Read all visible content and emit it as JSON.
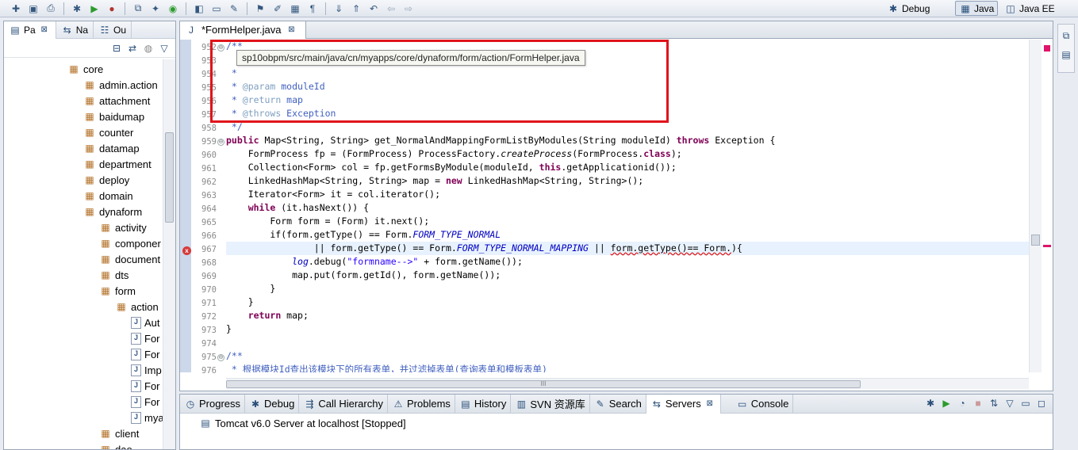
{
  "toolbar": {
    "perspectives": [
      {
        "label": "Debug",
        "icon": "debug-perspective-icon",
        "active": false
      },
      {
        "label": "Java",
        "icon": "java-perspective-icon",
        "active": true
      },
      {
        "label": "Java EE",
        "icon": "javaee-perspective-icon",
        "active": false
      }
    ]
  },
  "left_panel": {
    "tabs": [
      {
        "label": "Pa",
        "active": true,
        "close": "⊠"
      },
      {
        "label": "Na",
        "active": false
      },
      {
        "label": "Ou",
        "active": false
      }
    ],
    "tree": [
      {
        "label": "core",
        "depth": 0,
        "type": "package"
      },
      {
        "label": "admin.action",
        "depth": 1,
        "type": "package"
      },
      {
        "label": "attachment",
        "depth": 1,
        "type": "package"
      },
      {
        "label": "baidumap",
        "depth": 1,
        "type": "package"
      },
      {
        "label": "counter",
        "depth": 1,
        "type": "package"
      },
      {
        "label": "datamap",
        "depth": 1,
        "type": "package"
      },
      {
        "label": "department",
        "depth": 1,
        "type": "package"
      },
      {
        "label": "deploy",
        "depth": 1,
        "type": "package"
      },
      {
        "label": "domain",
        "depth": 1,
        "type": "package"
      },
      {
        "label": "dynaform",
        "depth": 1,
        "type": "package"
      },
      {
        "label": "activity",
        "depth": 2,
        "type": "package"
      },
      {
        "label": "componer",
        "depth": 2,
        "type": "package"
      },
      {
        "label": "document",
        "depth": 2,
        "type": "package"
      },
      {
        "label": "dts",
        "depth": 2,
        "type": "package"
      },
      {
        "label": "form",
        "depth": 2,
        "type": "package"
      },
      {
        "label": "action",
        "depth": 3,
        "type": "package"
      },
      {
        "label": "Aut",
        "depth": 4,
        "type": "file"
      },
      {
        "label": "For",
        "depth": 4,
        "type": "file"
      },
      {
        "label": "For",
        "depth": 4,
        "type": "file"
      },
      {
        "label": "Imp",
        "depth": 4,
        "type": "file"
      },
      {
        "label": "For",
        "depth": 4,
        "type": "file"
      },
      {
        "label": "For",
        "depth": 4,
        "type": "file"
      },
      {
        "label": "mya",
        "depth": 4,
        "type": "file"
      },
      {
        "label": "client",
        "depth": 2,
        "type": "package"
      },
      {
        "label": "dao",
        "depth": 2,
        "type": "package"
      }
    ]
  },
  "editor": {
    "tab_label": "*FormHelper.java",
    "tab_close": "⊠",
    "tooltip": "sp10obpm/src/main/java/cn/myapps/core/dynaform/form/action/FormHelper.java",
    "line_numbers": [
      "952",
      "953",
      "954",
      "955",
      "956",
      "957",
      "958",
      "959",
      "960",
      "961",
      "962",
      "963",
      "964",
      "965",
      "966",
      "967",
      "968",
      "969",
      "970",
      "971",
      "972",
      "973",
      "974",
      "975",
      "976"
    ],
    "error_marker": "x",
    "fold_marker": "⊖",
    "scroll_marker": "III",
    "lines": {
      "l952": "/**",
      "l954": " *",
      "l955_pre": " * ",
      "l955_tag": "@param",
      "l955_post": " moduleId",
      "l956_pre": " * ",
      "l956_tag": "@return",
      "l956_post": " map",
      "l957_pre": " * ",
      "l957_tag": "@throws",
      "l957_post": " Exception",
      "l958": " */",
      "l959_kw1": "public",
      "l959_mid": " Map<String, String> get_NormalAndMappingFormListByModules(String moduleId) ",
      "l959_kw2": "throws",
      "l959_post": " Exception {",
      "l960_a": "    FormProcess fp = (FormProcess) ProcessFactory.",
      "l960_it": "createProcess",
      "l960_b": "(FormProcess.",
      "l960_kw": "class",
      "l960_c": ");",
      "l961_a": "    Collection<Form> col = fp.getFormsByModule(moduleId, ",
      "l961_kw": "this",
      "l961_b": ".getApplicationid());",
      "l962_a": "    LinkedHashMap<String, String> map = ",
      "l962_kw": "new",
      "l962_b": " LinkedHashMap<String, String>();",
      "l963": "    Iterator<Form> it = col.iterator();",
      "l964_kw": "while",
      "l964_b": " (it.hasNext()) {",
      "l965": "        Form form = (Form) it.next();",
      "l966_a": "        if(form.getType() == Form.",
      "l966_fi": "FORM_TYPE_NORMAL",
      "l967_a": "                || form.getType() == Form.",
      "l967_fi": "FORM_TYPE_NORMAL_MAPPING",
      "l967_b": " || ",
      "l967_err": "form.getType()== Form.",
      "l967_c": "){",
      "l968_it": "log",
      "l968_a": ".debug(",
      "l968_st": "\"formname-->\"",
      "l968_b": " + form.getName());",
      "l969": "            map.put(form.getId(), form.getName());",
      "l970": "        }",
      "l971": "    }",
      "l972_kw": "return",
      "l972_b": " map;",
      "l973": "}",
      "l975": "/**",
      "l976": " * 根据模块Id查出该模块下的所有表单，并过滤掉表单(查询表单和模板表单)"
    }
  },
  "bottom_panel": {
    "tabs": [
      {
        "label": "Progress",
        "icon": "progress-icon",
        "active": false
      },
      {
        "label": "Debug",
        "icon": "debug-icon",
        "active": false
      },
      {
        "label": "Call Hierarchy",
        "icon": "call-hierarchy-icon",
        "active": false
      },
      {
        "label": "Problems",
        "icon": "problems-icon",
        "active": false
      },
      {
        "label": "History",
        "icon": "history-icon",
        "active": false
      },
      {
        "label": "SVN 资源库",
        "icon": "svn-icon",
        "active": false
      },
      {
        "label": "Search",
        "icon": "search-icon",
        "active": false
      },
      {
        "label": "Servers",
        "icon": "servers-icon",
        "active": true,
        "close": "⊠"
      },
      {
        "label": "Console",
        "icon": "console-icon",
        "active": false
      }
    ],
    "server_entry": "Tomcat v6.0 Server at localhost  [Stopped]"
  },
  "colors": {
    "keyword": "#7f0055",
    "comment": "#3f5fbf",
    "string": "#2a00ff",
    "field": "#0000c0",
    "annotation_box": "#e0141b",
    "error": "#d63a3a"
  }
}
